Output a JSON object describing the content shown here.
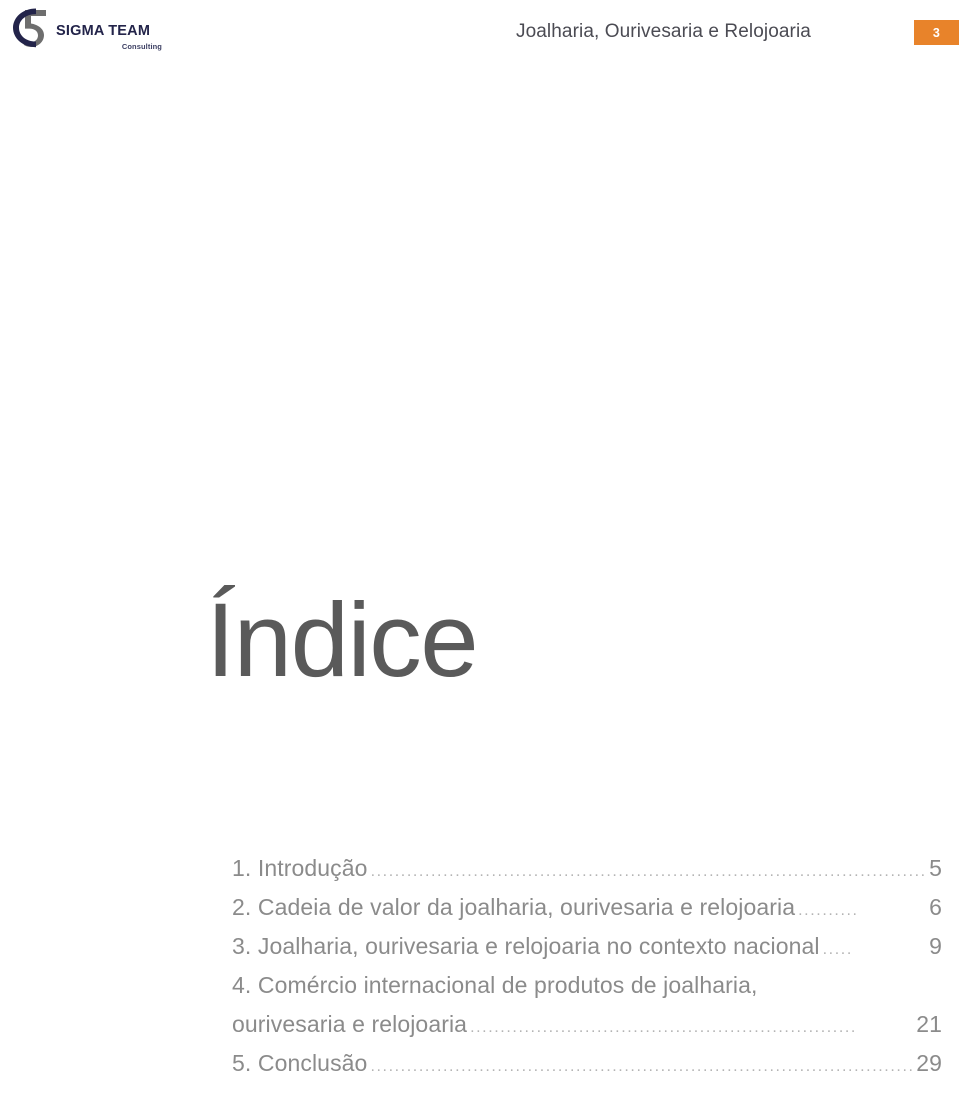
{
  "header": {
    "logo": {
      "mark_name": "sigma-team-logo-mark",
      "company_name": "SIGMA TEAM",
      "tagline": "Consulting",
      "mark_navy": "#23244a",
      "mark_gray": "#6e6e6e"
    },
    "document_title": "Joalharia, Ourivesaria e Relojoaria",
    "page_number": "3",
    "badge_color": "#e8832a"
  },
  "main": {
    "index_title": "Índice",
    "index_title_color": "#5a5a5a",
    "toc_entries": [
      {
        "label": "1. Introdução",
        "leader": "..................................................................................................",
        "page": "5",
        "has_leader": true
      },
      {
        "label": "2. Cadeia de valor da  joalharia,  ourivesaria e relojoaria",
        "leader": "..........",
        "page": "6",
        "has_leader": true
      },
      {
        "label": "3. Joalharia,  ourivesaria e relojoaria no contexto  nacional",
        "leader": ".....",
        "page": "9",
        "has_leader": true
      },
      {
        "label": "4. Comércio  internacional de produtos de joalharia,",
        "leader": "",
        "page": "",
        "has_leader": false
      },
      {
        "label": "ourivesaria e relojoaria",
        "leader": "................................................................",
        "page": "21",
        "has_leader": true
      },
      {
        "label": "5. Conclusão",
        "leader": ".......................................................................................................",
        "page": "29",
        "has_leader": true
      }
    ]
  }
}
